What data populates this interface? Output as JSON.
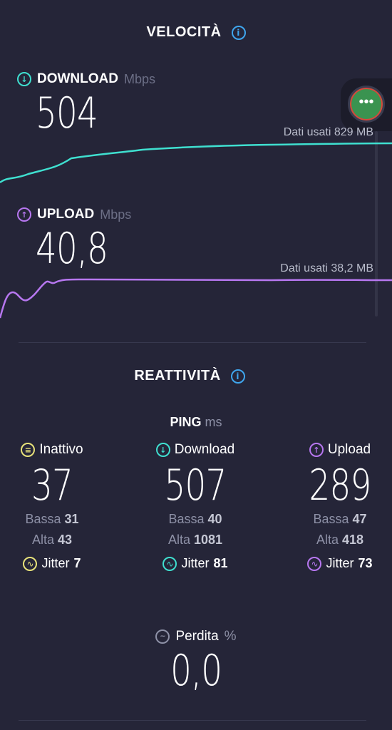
{
  "speed": {
    "title": "VELOCITÀ",
    "download": {
      "label": "DOWNLOAD",
      "unit": "Mbps",
      "value": "504",
      "data_used": "Dati usati 829 MB",
      "color": "#3fe0d0"
    },
    "upload": {
      "label": "UPLOAD",
      "unit": "Mbps",
      "value": "40,8",
      "data_used": "Dati usati 38,2 MB",
      "color": "#b777f0"
    }
  },
  "responsiveness": {
    "title": "REATTIVITÀ",
    "ping_label": "PING",
    "ping_unit": "ms",
    "columns": [
      {
        "label": "Inattivo",
        "value": "37",
        "low_label": "Bassa",
        "low": "31",
        "high_label": "Alta",
        "high": "43",
        "jitter_label": "Jitter",
        "jitter": "7",
        "color": "#e8e27a",
        "icon": "idle-icon"
      },
      {
        "label": "Download",
        "value": "507",
        "low_label": "Bassa",
        "low": "40",
        "high_label": "Alta",
        "high": "1081",
        "jitter_label": "Jitter",
        "jitter": "81",
        "color": "#3fe0d0",
        "icon": "download-arrow-icon"
      },
      {
        "label": "Upload",
        "value": "289",
        "low_label": "Bassa",
        "low": "47",
        "high_label": "Alta",
        "high": "418",
        "jitter_label": "Jitter",
        "jitter": "73",
        "color": "#b777f0",
        "icon": "upload-arrow-icon"
      }
    ],
    "loss": {
      "label": "Perdita",
      "unit": "%",
      "value": "0,0"
    }
  },
  "icons": {
    "info": "info-icon",
    "more": "more-options-icon",
    "jitter": "jitter-wave-icon",
    "loss": "packet-loss-icon"
  },
  "colors": {
    "background": "#252538",
    "accent_info": "#3fa6ee",
    "fab": "#3a9350"
  }
}
